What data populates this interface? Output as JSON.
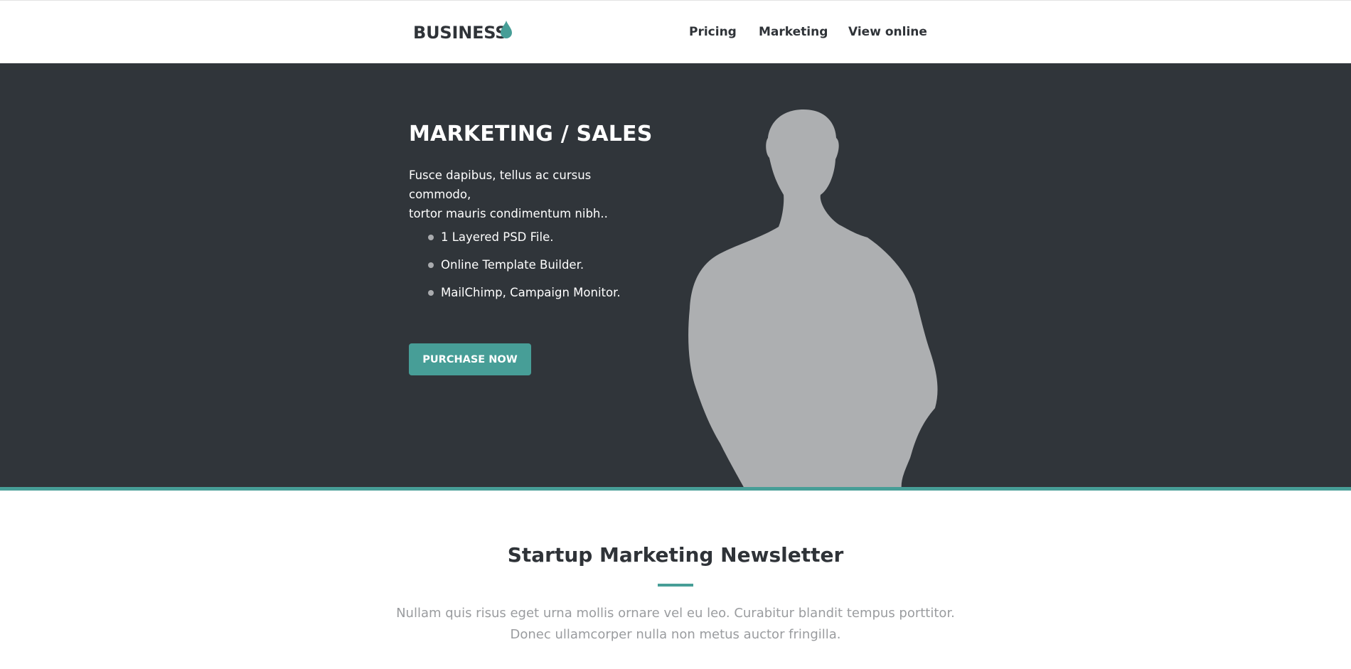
{
  "header": {
    "logo_text": "BUSINESS",
    "nav": [
      "Pricing",
      "Marketing",
      "View online"
    ]
  },
  "hero": {
    "title": "MARKETING / SALES",
    "description_lines": [
      "Fusce dapibus, tellus ac cursus commodo,",
      "tortor mauris condimentum nibh.."
    ],
    "features": [
      "1 Layered PSD File.",
      "Online Template Builder.",
      "MailChimp, Campaign Monitor."
    ],
    "cta_label": "PURCHASE NOW"
  },
  "newsletter": {
    "title": "Startup Marketing Newsletter",
    "text_lines": [
      "Nullam quis risus eget urna mollis ornare vel eu leo. Curabitur blandit tempus porttitor.",
      "Donec ullamcorper nulla non metus auctor fringilla."
    ]
  },
  "colors": {
    "accent": "#479e97",
    "dark": "#30353a",
    "text_dark": "#2f3338",
    "muted_text": "#9a9c9f",
    "silhouette": "#adafb1"
  },
  "icons": [
    "drop-icon",
    "bullet-dot-icon"
  ]
}
